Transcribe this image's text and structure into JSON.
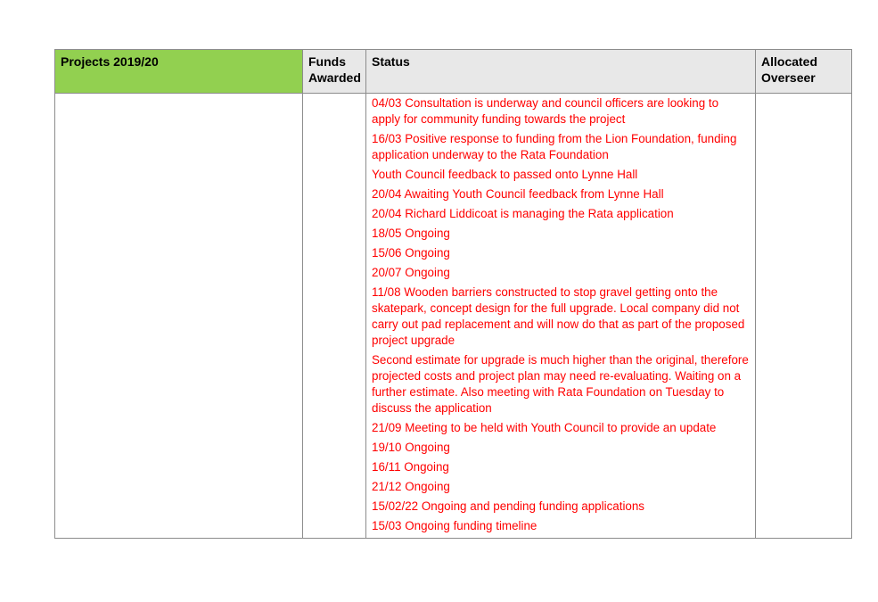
{
  "table": {
    "headers": {
      "project": "Projects 2019/20",
      "funds": "Funds\nAwarded",
      "status": "Status",
      "overseer": "Allocated\nOverseer"
    },
    "row": {
      "project": "",
      "funds": "",
      "overseer": "",
      "status_entries": [
        "04/03 Consultation is underway and council officers are looking to apply for community funding towards the project",
        "16/03 Positive response to funding from the Lion Foundation, funding application underway to the Rata Foundation",
        "Youth Council feedback to passed onto Lynne Hall",
        "20/04 Awaiting Youth Council feedback from Lynne Hall",
        "20/04 Richard Liddicoat is managing the Rata application",
        "18/05 Ongoing",
        "15/06 Ongoing",
        "20/07 Ongoing",
        "11/08 Wooden barriers constructed to stop gravel getting onto the skatepark, concept design for the full upgrade.  Local company did not carry out pad replacement and will now do that as part of the proposed project upgrade",
        "Second estimate for upgrade is much higher than the original, therefore projected costs and project plan may need re-evaluating.  Waiting on a further estimate.  Also meeting with Rata Foundation on Tuesday to discuss the application",
        "21/09 Meeting to be held with Youth Council to provide an update",
        "19/10 Ongoing",
        "16/11 Ongoing",
        "21/12 Ongoing",
        "15/02/22 Ongoing and pending funding applications",
        "15/03 Ongoing funding timeline"
      ]
    },
    "colors": {
      "header_project_bg": "#92d050",
      "header_bg": "#e8e8e8",
      "status_text": "#ff0000",
      "border": "#8c8c8c"
    }
  }
}
